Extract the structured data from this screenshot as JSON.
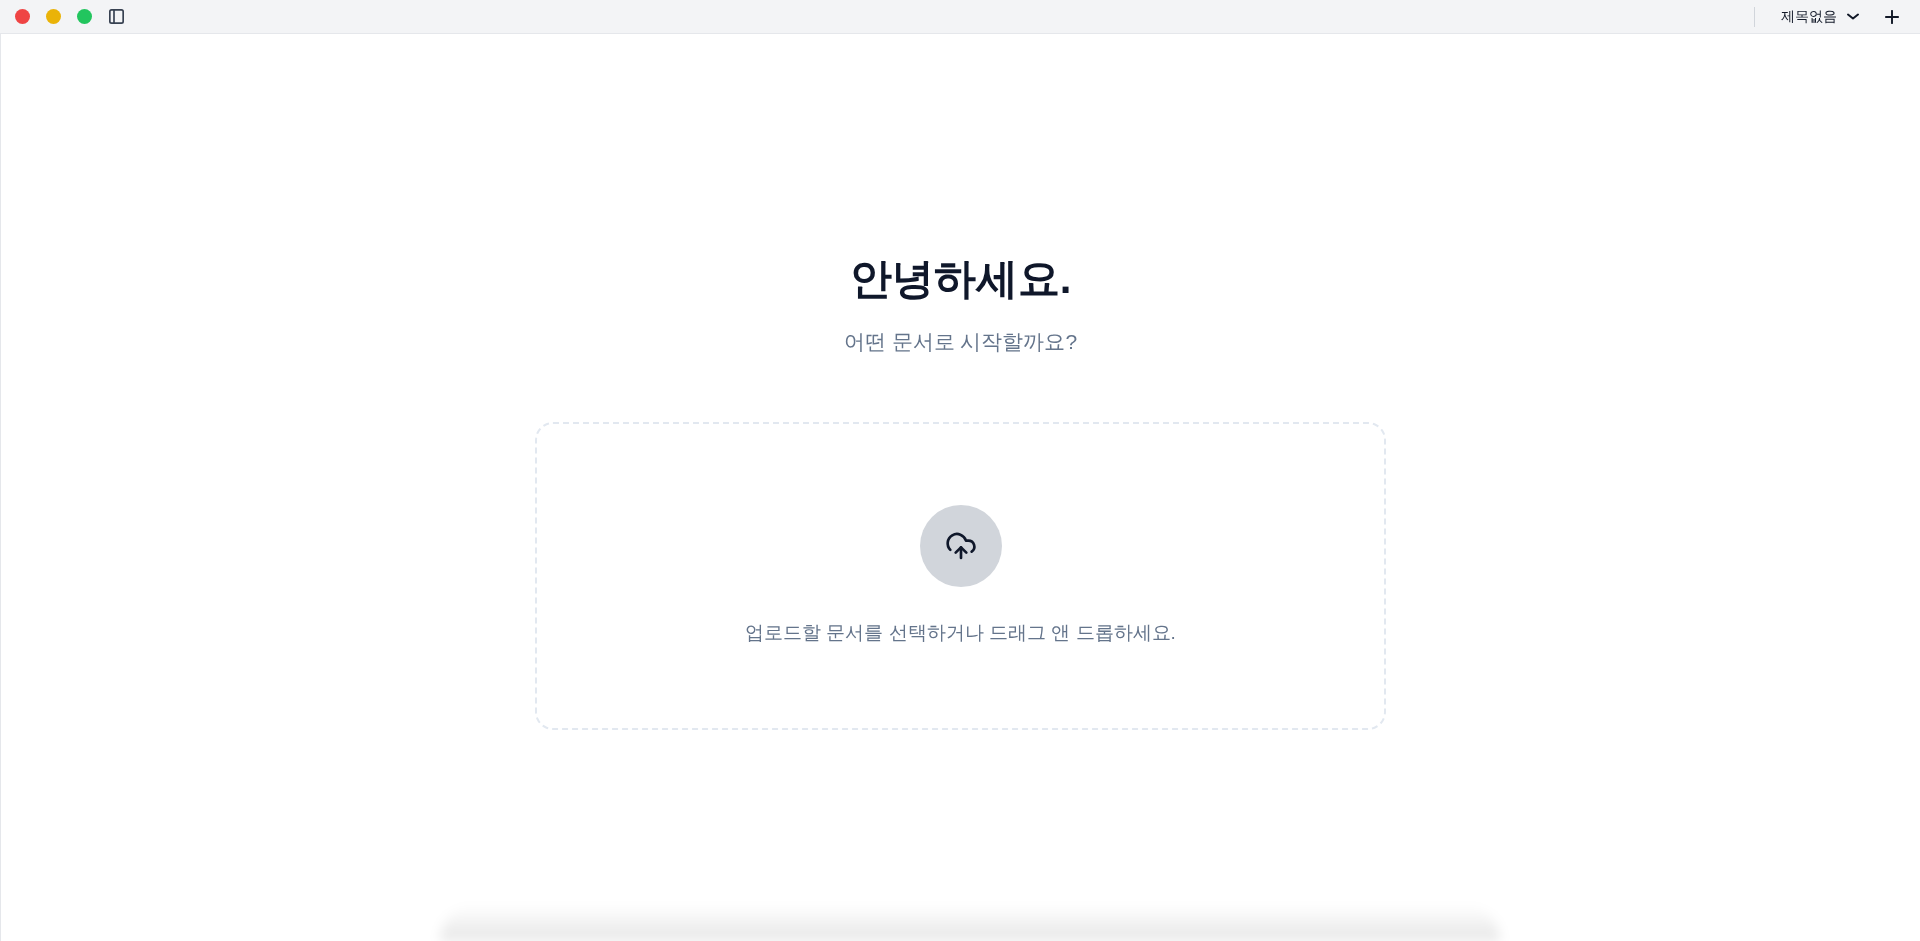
{
  "titlebar": {
    "window_controls": [
      {
        "color": "#ef4444"
      },
      {
        "color": "#eab308"
      },
      {
        "color": "#22c55e"
      }
    ],
    "document_title": "제목없음"
  },
  "main": {
    "heading": "안녕하세요.",
    "subtitle": "어떤 문서로 시작할까요?",
    "upload": {
      "hint": "업로드할 문서를 선택하거나 드래그 앤 드롭하세요."
    }
  }
}
